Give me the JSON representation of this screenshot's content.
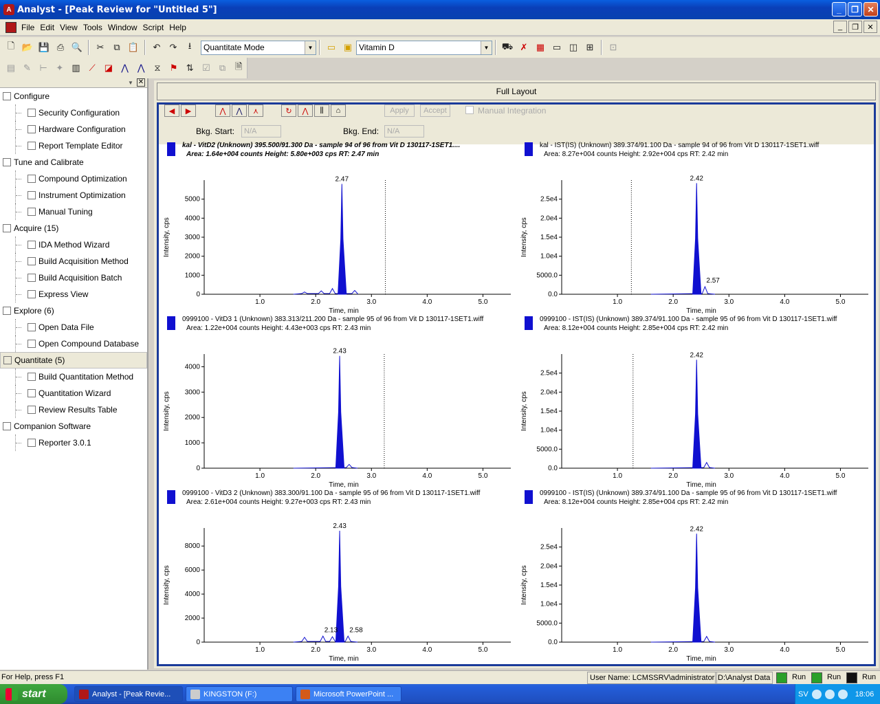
{
  "window": {
    "title": "Analyst - [Peak Review for \"Untitled 5\"]",
    "buttons": [
      "_",
      "❐",
      "✕"
    ]
  },
  "menu": [
    "File",
    "Edit",
    "View",
    "Tools",
    "Window",
    "Script",
    "Help"
  ],
  "toolbar": {
    "mode_value": "Quantitate Mode",
    "project_value": "Vitamin D"
  },
  "nav": {
    "items": [
      {
        "label": "Configure",
        "type": "cat",
        "icon": "configure-icon"
      },
      {
        "label": "Security Configuration",
        "type": "sub",
        "icon": "key-icon"
      },
      {
        "label": "Hardware Configuration",
        "type": "sub",
        "icon": "grid-icon"
      },
      {
        "label": "Report Template Editor",
        "type": "sub",
        "icon": "report-icon"
      },
      {
        "label": "Tune and Calibrate",
        "type": "cat",
        "icon": "tune-icon"
      },
      {
        "label": "Compound Optimization",
        "type": "sub",
        "icon": "peak-icon"
      },
      {
        "label": "Instrument Optimization",
        "type": "sub",
        "icon": "instrument-icon"
      },
      {
        "label": "Manual Tuning",
        "type": "sub",
        "icon": "tuning-icon"
      },
      {
        "label": "Acquire  (15)",
        "type": "cat",
        "icon": "acquire-icon"
      },
      {
        "label": "IDA Method Wizard",
        "type": "sub",
        "icon": "wand-icon"
      },
      {
        "label": "Build Acquisition Method",
        "type": "sub",
        "icon": "method-icon"
      },
      {
        "label": "Build Acquisition Batch",
        "type": "sub",
        "icon": "batch-icon"
      },
      {
        "label": "Express View",
        "type": "sub",
        "icon": "express-icon"
      },
      {
        "label": "Explore  (6)",
        "type": "cat",
        "icon": "explore-icon"
      },
      {
        "label": "Open Data File",
        "type": "sub",
        "icon": "folder-icon"
      },
      {
        "label": "Open Compound Database",
        "type": "sub",
        "icon": "database-icon"
      },
      {
        "label": "Quantitate  (5)",
        "type": "cat",
        "icon": "quantitate-icon",
        "active": true
      },
      {
        "label": "Build Quantitation Method",
        "type": "sub",
        "icon": "build-quant-icon"
      },
      {
        "label": "Quantitation Wizard",
        "type": "sub",
        "icon": "wand-icon"
      },
      {
        "label": "Review Results Table",
        "type": "sub",
        "icon": "checklist-icon"
      },
      {
        "label": "Companion Software",
        "type": "cat",
        "icon": "companion-icon"
      },
      {
        "label": "Reporter 3.0.1",
        "type": "sub",
        "icon": "reporter-icon"
      }
    ]
  },
  "layout_bar": "Full Layout",
  "controls": {
    "apply": "Apply",
    "accept": "Accept",
    "manual_integration": "Manual Integration",
    "bkg_start_label": "Bkg. Start:",
    "bkg_start_value": "N/A",
    "bkg_end_label": "Bkg. End:",
    "bkg_end_value": "N/A"
  },
  "panels": [
    {
      "line1": "kal          - VitD2 (Unknown) 395.500/91.300 Da - sample 94 of 96 from Vit D 130117-1SET1....",
      "line2": "Area: 1.64e+004 counts  Height: 5.80e+003 cps  RT: 2.47 min",
      "bold": true,
      "chart_data": {
        "type": "line",
        "xlabel": "Time, min",
        "ylabel": "Intensity, cps",
        "xlim": [
          0,
          5.5
        ],
        "ylim": [
          0,
          6000
        ],
        "xticks": [
          "1.0",
          "2.0",
          "3.0",
          "4.0",
          "5.0"
        ],
        "yticks": [
          "0",
          "1000",
          "2000",
          "3000",
          "4000",
          "5000"
        ],
        "yticks_values": [
          0,
          1000,
          2000,
          3000,
          4000,
          5000
        ],
        "peak_rt": 2.47,
        "peak_height": 5800,
        "peak_label": "2.47",
        "marker_x": 3.25,
        "minor_peaks": [
          [
            1.8,
            120
          ],
          [
            2.1,
            180
          ],
          [
            2.3,
            300
          ],
          [
            2.7,
            200
          ]
        ],
        "extra_labels": []
      }
    },
    {
      "line1": "kal        - IST(IS) (Unknown) 389.374/91.100 Da - sample 94 of 96 from Vit D 130117-1SET1.wiff",
      "line2": "Area: 8.27e+004 counts  Height: 2.92e+004 cps  RT: 2.42 min",
      "bold": false,
      "chart_data": {
        "type": "line",
        "xlabel": "Time, min",
        "ylabel": "Intensity, cps",
        "xlim": [
          0,
          5.5
        ],
        "ylim": [
          0,
          30000
        ],
        "xticks": [
          "1.0",
          "2.0",
          "3.0",
          "4.0",
          "5.0"
        ],
        "yticks": [
          "0.0",
          "5000.0",
          "1.0e4",
          "1.5e4",
          "2.0e4",
          "2.5e4"
        ],
        "yticks_values": [
          0,
          5000,
          10000,
          15000,
          20000,
          25000
        ],
        "peak_rt": 2.42,
        "peak_height": 29200,
        "peak_label": "2.42",
        "marker_x": 1.25,
        "minor_peaks": [
          [
            2.57,
            2000
          ]
        ],
        "extra_labels": [
          {
            "text": "2.57",
            "x": 2.57,
            "y": 2000
          }
        ]
      }
    },
    {
      "line1": "0999100 - VitD3 1 (Unknown) 383.313/211.200 Da - sample 95 of 96 from Vit D 130117-1SET1.wiff",
      "line2": "Area: 1.22e+004 counts  Height: 4.43e+003 cps  RT: 2.43 min",
      "bold": false,
      "chart_data": {
        "type": "line",
        "xlabel": "Time, min",
        "ylabel": "Intensity, cps",
        "xlim": [
          0,
          5.5
        ],
        "ylim": [
          0,
          4500
        ],
        "xticks": [
          "1.0",
          "2.0",
          "3.0",
          "4.0",
          "5.0"
        ],
        "yticks": [
          "0",
          "1000",
          "2000",
          "3000",
          "4000"
        ],
        "yticks_values": [
          0,
          1000,
          2000,
          3000,
          4000
        ],
        "peak_rt": 2.43,
        "peak_height": 4430,
        "peak_label": "2.43",
        "marker_x": 3.23,
        "minor_peaks": [
          [
            2.6,
            150
          ]
        ],
        "extra_labels": []
      }
    },
    {
      "line1": "0999100 - IST(IS) (Unknown) 389.374/91.100 Da - sample 95 of 96 from Vit D 130117-1SET1.wiff",
      "line2": "Area: 8.12e+004 counts  Height: 2.85e+004 cps  RT: 2.42 min",
      "bold": false,
      "chart_data": {
        "type": "line",
        "xlabel": "Time, min",
        "ylabel": "Intensity, cps",
        "xlim": [
          0,
          5.5
        ],
        "ylim": [
          0,
          30000
        ],
        "xticks": [
          "1.0",
          "2.0",
          "3.0",
          "4.0",
          "5.0"
        ],
        "yticks": [
          "0.0",
          "5000.0",
          "1.0e4",
          "1.5e4",
          "2.0e4",
          "2.5e4"
        ],
        "yticks_values": [
          0,
          5000,
          10000,
          15000,
          20000,
          25000
        ],
        "peak_rt": 2.42,
        "peak_height": 28500,
        "peak_label": "2.42",
        "marker_x": 1.28,
        "minor_peaks": [
          [
            2.6,
            1500
          ]
        ],
        "extra_labels": []
      }
    },
    {
      "line1": "0999100 - VitD3 2 (Unknown) 383.300/91.100 Da - sample 95 of 96 from Vit D 130117-1SET1.wiff",
      "line2": "Area: 2.61e+004 counts  Height: 9.27e+003 cps  RT: 2.43 min",
      "bold": false,
      "chart_data": {
        "type": "line",
        "xlabel": "Time, min",
        "ylabel": "Intensity, cps",
        "xlim": [
          0,
          5.5
        ],
        "ylim": [
          0,
          9500
        ],
        "xticks": [
          "1.0",
          "2.0",
          "3.0",
          "4.0",
          "5.0"
        ],
        "yticks": [
          "0",
          "2000",
          "4000",
          "6000",
          "8000"
        ],
        "yticks_values": [
          0,
          2000,
          4000,
          6000,
          8000
        ],
        "peak_rt": 2.43,
        "peak_height": 9270,
        "peak_label": "2.43",
        "marker_x": null,
        "minor_peaks": [
          [
            1.8,
            400
          ],
          [
            2.13,
            500
          ],
          [
            2.3,
            450
          ],
          [
            2.58,
            500
          ]
        ],
        "extra_labels": [
          {
            "text": "2.13",
            "x": 2.13,
            "y": 500
          },
          {
            "text": "2.58",
            "x": 2.58,
            "y": 500
          }
        ]
      }
    },
    {
      "line1": "0999100 - IST(IS) (Unknown) 389.374/91.100 Da - sample 95 of 96 from Vit D 130117-1SET1.wiff",
      "line2": "Area: 8.12e+004 counts  Height: 2.85e+004 cps  RT: 2.42 min",
      "bold": false,
      "chart_data": {
        "type": "line",
        "xlabel": "Time, min",
        "ylabel": "Intensity, cps",
        "xlim": [
          0,
          5.5
        ],
        "ylim": [
          0,
          30000
        ],
        "xticks": [
          "1.0",
          "2.0",
          "3.0",
          "4.0",
          "5.0"
        ],
        "yticks": [
          "0.0",
          "5000.0",
          "1.0e4",
          "1.5e4",
          "2.0e4",
          "2.5e4"
        ],
        "yticks_values": [
          0,
          5000,
          10000,
          15000,
          20000,
          25000
        ],
        "peak_rt": 2.42,
        "peak_height": 28500,
        "peak_label": "2.42",
        "marker_x": null,
        "minor_peaks": [
          [
            2.6,
            1500
          ]
        ],
        "extra_labels": []
      }
    }
  ],
  "status": {
    "help": "For Help, press F1",
    "user": "User Name: LCMSSRV\\administrator",
    "path": "D:\\Analyst Data",
    "run1": "Run",
    "run2": "Run",
    "run3": "Run"
  },
  "taskbar": {
    "start": "start",
    "tasks": [
      "Analyst - [Peak Revie...",
      "KINGSTON (F:)",
      "Microsoft PowerPoint ..."
    ],
    "lang": "SV",
    "clock": "18:06"
  },
  "colors": {
    "trace": "#1010d0",
    "accent": "#1a3a9a"
  }
}
